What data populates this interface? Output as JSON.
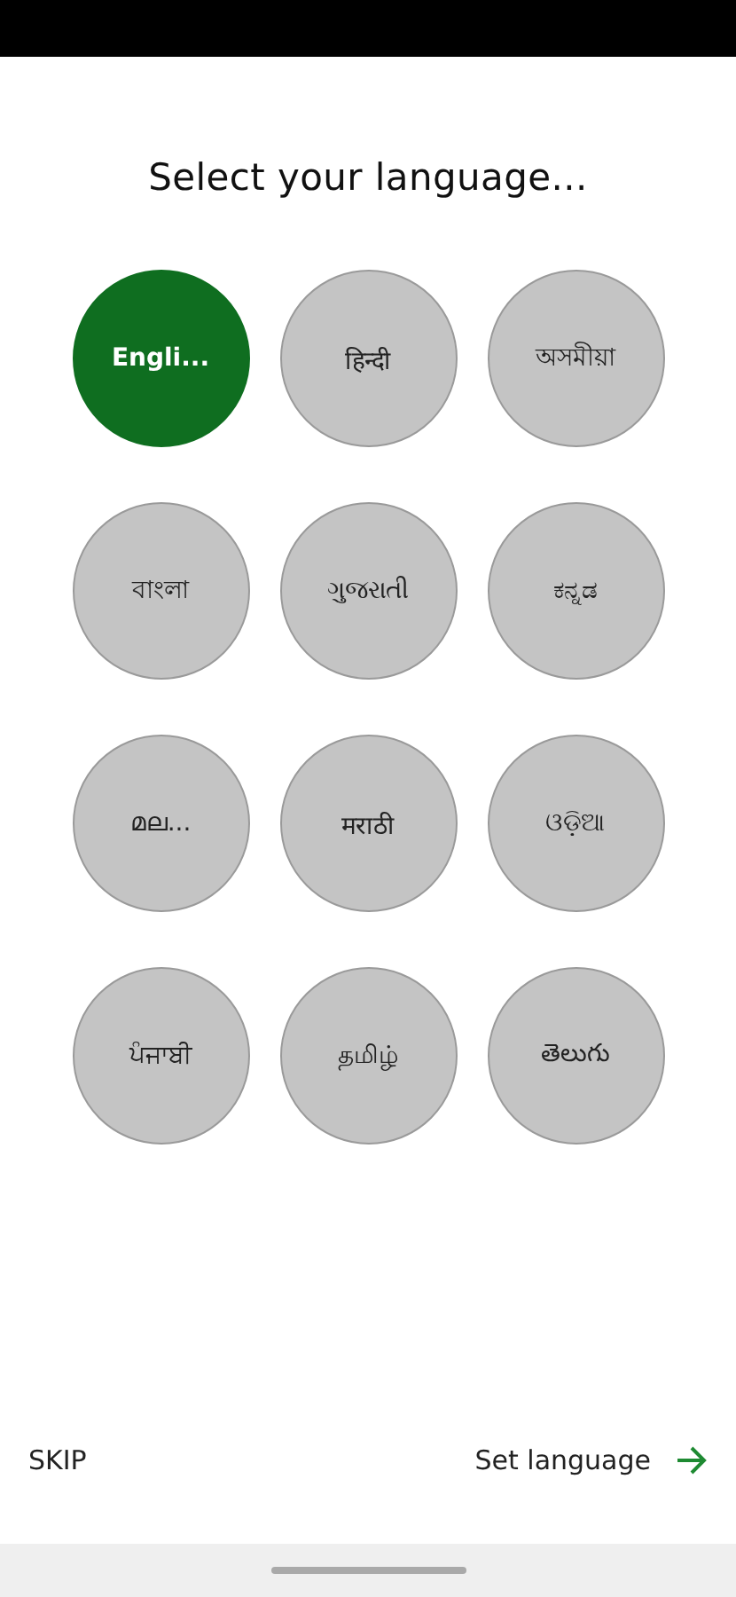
{
  "title": "Select your language...",
  "languages": [
    {
      "label": "Engli...",
      "selected": true
    },
    {
      "label": "हिन्दी",
      "selected": false
    },
    {
      "label": "অসমীয়া",
      "selected": false
    },
    {
      "label": "বাংলা",
      "selected": false
    },
    {
      "label": "ગુજરાતી",
      "selected": false
    },
    {
      "label": "ಕನ್ನಡ",
      "selected": false
    },
    {
      "label": "മല...",
      "selected": false
    },
    {
      "label": "मराठी",
      "selected": false
    },
    {
      "label": "ଓଡ଼ିଆ",
      "selected": false
    },
    {
      "label": "ਪੰਜਾਬੀ",
      "selected": false
    },
    {
      "label": "தமிழ்",
      "selected": false
    },
    {
      "label": "తెలుగు",
      "selected": false
    }
  ],
  "footer": {
    "skip": "SKIP",
    "confirm": "Set language"
  }
}
